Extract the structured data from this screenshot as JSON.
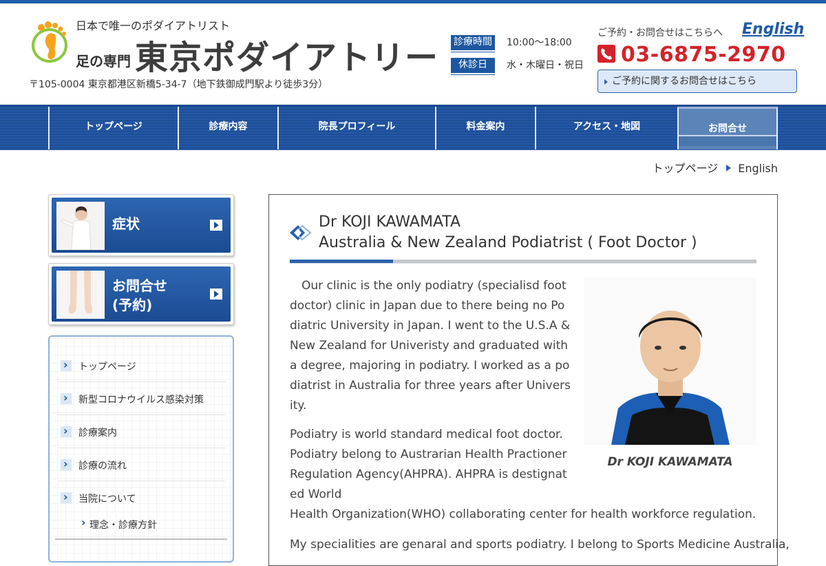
{
  "header": {
    "tagline": "日本で唯一のポダイアトリスト",
    "sub_prefix": "足の専門",
    "site_title": "東京ポダイアトリー",
    "address": "〒105-0004 東京都港区新橋5-34-7（地下鉄御成門駅より徒歩3分）",
    "hours_label": "診療時間",
    "hours_value": "10:00〜18:00",
    "closed_label": "休診日",
    "closed_value": "水・木曜日・祝日",
    "contact_note": "ご予約・お問合せはこちらへ",
    "english_link": "English",
    "phone": "03-6875-2970",
    "contact_button": "ご予約に関するお問合せはこちら"
  },
  "nav": {
    "items": [
      {
        "label": "トップページ"
      },
      {
        "label": "診療内容"
      },
      {
        "label": "院長プロフィール"
      },
      {
        "label": "料金案内"
      },
      {
        "label": "アクセス・地図"
      },
      {
        "label": "お問合せ"
      }
    ]
  },
  "breadcrumb": {
    "home": "トップページ",
    "current": "English"
  },
  "side_banners": [
    {
      "label": "症状"
    },
    {
      "label_line1": "お問合せ",
      "label_line2": "(予約)"
    }
  ],
  "side_menu": {
    "items": [
      {
        "label": "トップページ"
      },
      {
        "label": "新型コロナウイルス感染対策"
      },
      {
        "label": "診療案内"
      },
      {
        "label": "診療の流れ"
      },
      {
        "label": "当院について"
      }
    ],
    "sub_items": [
      {
        "label": "理念・診療方針"
      }
    ]
  },
  "main": {
    "heading_line1": "Dr KOJI KAWAMATA",
    "heading_line2": "Australia & New Zealand Podiatrist ( Foot Doctor )",
    "para1": "Our clinic is the only podiatry (specialisd foot doctor) clinic in Japan due to there being no Podiatric University in Japan. I went to the U.S.A & New Zealand for Univeristy and graduated with a degree, majoring in podiatry. I worked as a podiatrist in Australia for three years after University.",
    "para2_a": "Podiatry is world standard medical foot doctor. Podiatry belong to Austrarian Health Practioner Regulation Agency(AHPRA). AHPRA is destignated World",
    "para2_b": "Health Organization(WHO) collaborating center for health workforce regulation.",
    "para3": "My specialities are genaral and sports podiatry. I belong to Sports Medicine Australia,",
    "photo_caption": "Dr KOJI KAWAMATA"
  },
  "colors": {
    "brand_blue": "#1f5ea8",
    "phone_red": "#d3232a"
  },
  "icons": [
    "foot-logo-icon",
    "phone-icon",
    "arrow-right-icon",
    "chevron-right-icon",
    "diamond-heading-icon"
  ]
}
